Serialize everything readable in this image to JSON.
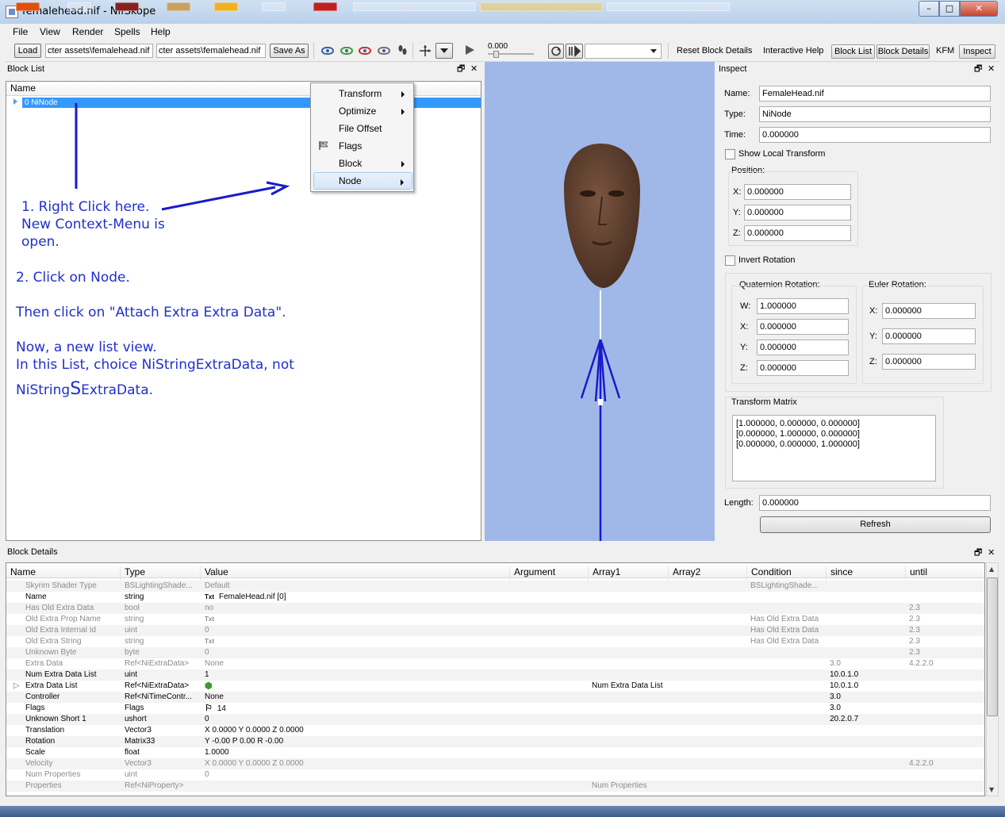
{
  "window": {
    "title": "femalehead.nif - NifSkope",
    "close_glyph": "✕",
    "min_glyph": "–",
    "max_glyph": "□"
  },
  "menus": [
    "File",
    "View",
    "Render",
    "Spells",
    "Help"
  ],
  "toolbar": {
    "load_label": "Load",
    "load_path": "cter assets\\femalehead.nif",
    "save_path": "cter assets\\femalehead.nif",
    "save_as_label": "Save As",
    "time_value": "0.000",
    "reset_label": "Reset Block Details",
    "interactive_help_label": "Interactive Help",
    "block_list_label": "Block List",
    "block_details_label": "Block Details",
    "kfm_label": "KFM",
    "inspect_label": "Inspect"
  },
  "block_list": {
    "title": "Block List",
    "column_name": "Name",
    "root_node": "0 NiNode",
    "float_glyph": "🗗",
    "close_glyph": "✕"
  },
  "context_menu": {
    "items": [
      {
        "label": "Transform",
        "submenu": true
      },
      {
        "label": "Optimize",
        "submenu": true
      },
      {
        "label": "File Offset",
        "submenu": false
      },
      {
        "label": "Flags",
        "submenu": false,
        "icon": "flag-icon"
      },
      {
        "label": "Block",
        "submenu": true
      },
      {
        "label": "Node",
        "submenu": true,
        "highlighted": true
      }
    ]
  },
  "annotations": {
    "line1": "1. Right Click here.",
    "line2": "New Context-Menu is",
    "line3": "open.",
    "line4": "2. Click on Node.",
    "line5": "Then click on \"Attach Extra Extra Data\".",
    "line6": "Now, a new list view.",
    "line7": "In this List, choice NiStringExtraData, not",
    "line8a": "NiString",
    "line8b": "S",
    "line8c": "ExtraData.",
    "color": "#1f2fcf"
  },
  "inspect": {
    "title": "Inspect",
    "name_label": "Name:",
    "name_value": "FemaleHead.nif",
    "type_label": "Type:",
    "type_value": "NiNode",
    "time_label": "Time:",
    "time_value": "0.000000",
    "show_local_label": "Show Local Transform",
    "position_label": "Position:",
    "x_label": "X:",
    "y_label": "Y:",
    "z_label": "Z:",
    "w_label": "W:",
    "pos_x": "0.000000",
    "pos_y": "0.000000",
    "pos_z": "0.000000",
    "invert_rotation_label": "Invert Rotation",
    "quat_label": "Quaternion Rotation:",
    "quat_w": "1.000000",
    "quat_x": "0.000000",
    "quat_y": "0.000000",
    "quat_z": "0.000000",
    "euler_label": "Euler Rotation:",
    "euler_x": "0.000000",
    "euler_y": "0.000000",
    "euler_z": "0.000000",
    "matrix_label": "Transform Matrix",
    "matrix_rows": [
      "[1.000000, 0.000000, 0.000000]",
      "[0.000000, 1.000000, 0.000000]",
      "[0.000000, 0.000000, 1.000000]"
    ],
    "length_label": "Length:",
    "length_value": "0.000000",
    "refresh_label": "Refresh"
  },
  "block_details": {
    "title": "Block Details",
    "columns": [
      "Name",
      "Type",
      "Value",
      "Argument",
      "Array1",
      "Array2",
      "Condition",
      "since",
      "until"
    ],
    "rows": [
      {
        "name": "Skyrim Shader Type",
        "type": "BSLightingShade...",
        "value": "Default",
        "arg": "",
        "a1": "",
        "a2": "",
        "cond": "BSLightingShade...",
        "since": "",
        "until": "",
        "grey": true
      },
      {
        "name": "Name",
        "type": "string",
        "value": "FemaleHead.nif [0]",
        "txt": true,
        "arg": "",
        "a1": "",
        "a2": "",
        "cond": "",
        "since": "",
        "until": "",
        "grey": false
      },
      {
        "name": "Has Old Extra Data",
        "type": "bool",
        "value": "no",
        "arg": "",
        "a1": "",
        "a2": "",
        "cond": "",
        "since": "",
        "until": "2.3",
        "grey": true
      },
      {
        "name": "Old Extra Prop Name",
        "type": "string",
        "value": "",
        "txt": true,
        "arg": "",
        "a1": "",
        "a2": "",
        "cond": "Has Old Extra Data",
        "since": "",
        "until": "2.3",
        "grey": true
      },
      {
        "name": "Old Extra Internal Id",
        "type": "uint",
        "value": "0",
        "arg": "",
        "a1": "",
        "a2": "",
        "cond": "Has Old Extra Data",
        "since": "",
        "until": "2.3",
        "grey": true
      },
      {
        "name": "Old Extra String",
        "type": "string",
        "value": "",
        "txt": true,
        "arg": "",
        "a1": "",
        "a2": "",
        "cond": "Has Old Extra Data",
        "since": "",
        "until": "2.3",
        "grey": true
      },
      {
        "name": "Unknown Byte",
        "type": "byte",
        "value": "0",
        "arg": "",
        "a1": "",
        "a2": "",
        "cond": "",
        "since": "",
        "until": "2.3",
        "grey": true
      },
      {
        "name": "Extra Data",
        "type": "Ref<NiExtraData>",
        "value": "None",
        "arg": "",
        "a1": "",
        "a2": "",
        "cond": "",
        "since": "3.0",
        "until": "4.2.2.0",
        "grey": true
      },
      {
        "name": "Num Extra Data List",
        "type": "uint",
        "value": "1",
        "arg": "",
        "a1": "",
        "a2": "",
        "cond": "",
        "since": "10.0.1.0",
        "until": "",
        "grey": false
      },
      {
        "name": "Extra Data List",
        "type": "Ref<NiExtraData>",
        "value": "",
        "link": true,
        "arg": "",
        "a1": "Num Extra Data List",
        "a2": "",
        "cond": "",
        "since": "10.0.1.0",
        "until": "",
        "grey": false,
        "expand": true
      },
      {
        "name": "Controller",
        "type": "Ref<NiTimeContr...",
        "value": "None",
        "arg": "",
        "a1": "",
        "a2": "",
        "cond": "",
        "since": "3.0",
        "until": "",
        "grey": false
      },
      {
        "name": "Flags",
        "type": "Flags",
        "value": "14",
        "flag": true,
        "arg": "",
        "a1": "",
        "a2": "",
        "cond": "",
        "since": "3.0",
        "until": "",
        "grey": false
      },
      {
        "name": "Unknown Short 1",
        "type": "ushort",
        "value": "0",
        "arg": "",
        "a1": "",
        "a2": "",
        "cond": "",
        "since": "20.2.0.7",
        "until": "",
        "grey": false
      },
      {
        "name": "Translation",
        "type": "Vector3",
        "value": "X 0.0000 Y 0.0000 Z 0.0000",
        "arg": "",
        "a1": "",
        "a2": "",
        "cond": "",
        "since": "",
        "until": "",
        "grey": false
      },
      {
        "name": "Rotation",
        "type": "Matrix33",
        "value": "Y -0.00 P 0.00 R -0.00",
        "arg": "",
        "a1": "",
        "a2": "",
        "cond": "",
        "since": "",
        "until": "",
        "grey": false
      },
      {
        "name": "Scale",
        "type": "float",
        "value": "1.0000",
        "arg": "",
        "a1": "",
        "a2": "",
        "cond": "",
        "since": "",
        "until": "",
        "grey": false
      },
      {
        "name": "Velocity",
        "type": "Vector3",
        "value": "X 0.0000 Y 0.0000 Z 0.0000",
        "arg": "",
        "a1": "",
        "a2": "",
        "cond": "",
        "since": "",
        "until": "4.2.2.0",
        "grey": true
      },
      {
        "name": "Num Properties",
        "type": "uint",
        "value": "0",
        "arg": "",
        "a1": "",
        "a2": "",
        "cond": "",
        "since": "",
        "until": "",
        "grey": true
      },
      {
        "name": "Properties",
        "type": "Ref<NiProperty>",
        "value": "",
        "arg": "",
        "a1": "Num Properties",
        "a2": "",
        "cond": "",
        "since": "",
        "until": "",
        "grey": true
      }
    ]
  },
  "colors": {
    "selection": "#3399ff",
    "viewport_bg": "#a0b8e8",
    "bone_blue": "#1a1acc"
  }
}
